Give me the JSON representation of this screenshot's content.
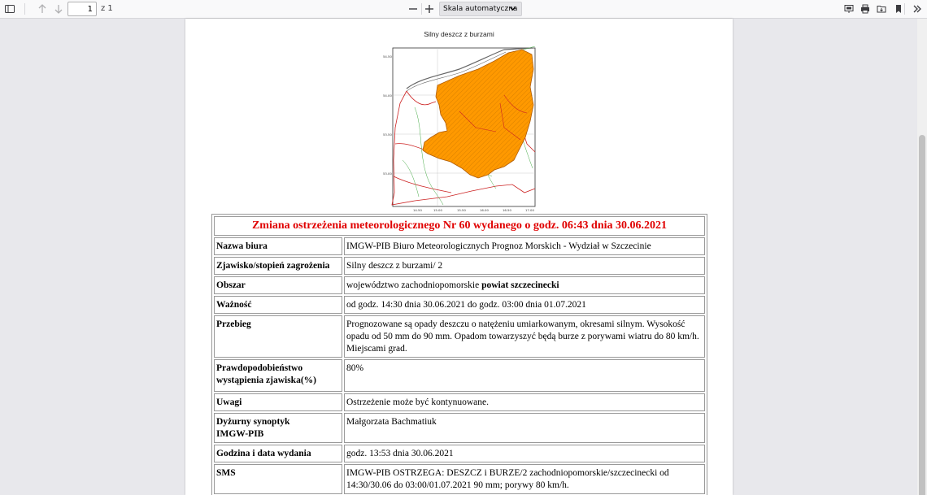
{
  "toolbar": {
    "page_number": "1",
    "page_count": "z 1",
    "zoom_label": "Skala automatyczna",
    "icons": [
      "sidebar-toggle-icon",
      "arrow-up-icon",
      "arrow-down-icon",
      "minus-icon",
      "plus-icon",
      "presentation-icon",
      "print-icon",
      "open-folder-icon",
      "bookmark-icon",
      "more-tools-icon"
    ]
  },
  "document": {
    "map_title": "Silny deszcz z burzami",
    "map_lat_labels": [
      "54.50",
      "54.00",
      "53.50",
      "53.00"
    ],
    "map_lon_labels": [
      "14.50",
      "15.00",
      "15.50",
      "16.00",
      "16.50",
      "17.00"
    ],
    "map_colors": {
      "warning_area": "#ff9900",
      "borders": "#cc2222",
      "coast": "#666666",
      "rivers": "#44aa44"
    },
    "header": "Zmiana ostrzeżenia meteorologicznego Nr 60 wydanego o godz. 06:43 dnia 30.06.2021",
    "rows": {
      "office_label": "Nazwa biura",
      "office_value": "IMGW-PIB Biuro Meteorologicznych Prognoz Morskich - Wydział w Szczecinie",
      "phenomenon_label": "Zjawisko/stopień zagrożenia",
      "phenomenon_value": "Silny deszcz z burzami/ 2",
      "area_label": "Obszar",
      "area_value_prefix": "województwo zachodniopomorskie ",
      "area_value_bold": "powiat szczecinecki",
      "validity_label": "Ważność",
      "validity_value": "od godz. 14:30 dnia 30.06.2021 do godz. 03:00 dnia 01.07.2021",
      "course_label": "Przebieg",
      "course_value": "Prognozowane są opady deszczu o natężeniu umiarkowanym, okresami silnym. Wysokość opadu od 50 mm do 90 mm. Opadom towarzyszyć będą burze z porywami wiatru do 80 km/h. Miejscami grad.",
      "probability_label": "Prawdopodobieństwo wystąpienia zjawiska(%)",
      "probability_value": "80%",
      "notes_label": "Uwagi",
      "notes_value": "Ostrzeżenie może być kontynuowane.",
      "forecaster_label_1": "Dyżurny synoptyk",
      "forecaster_label_2": "IMGW-PIB",
      "forecaster_value": "Małgorzata Bachmatiuk",
      "issued_label": "Godzina i data wydania",
      "issued_value": "godz. 13:53 dnia 30.06.2021",
      "sms_label": "SMS",
      "sms_value": "IMGW-PIB OSTRZEGA: DESZCZ i BURZE/2 zachodniopomorskie/szczecinecki od 14:30/30.06 do 03:00/01.07.2021 90 mm; porywy 80 km/h."
    }
  }
}
